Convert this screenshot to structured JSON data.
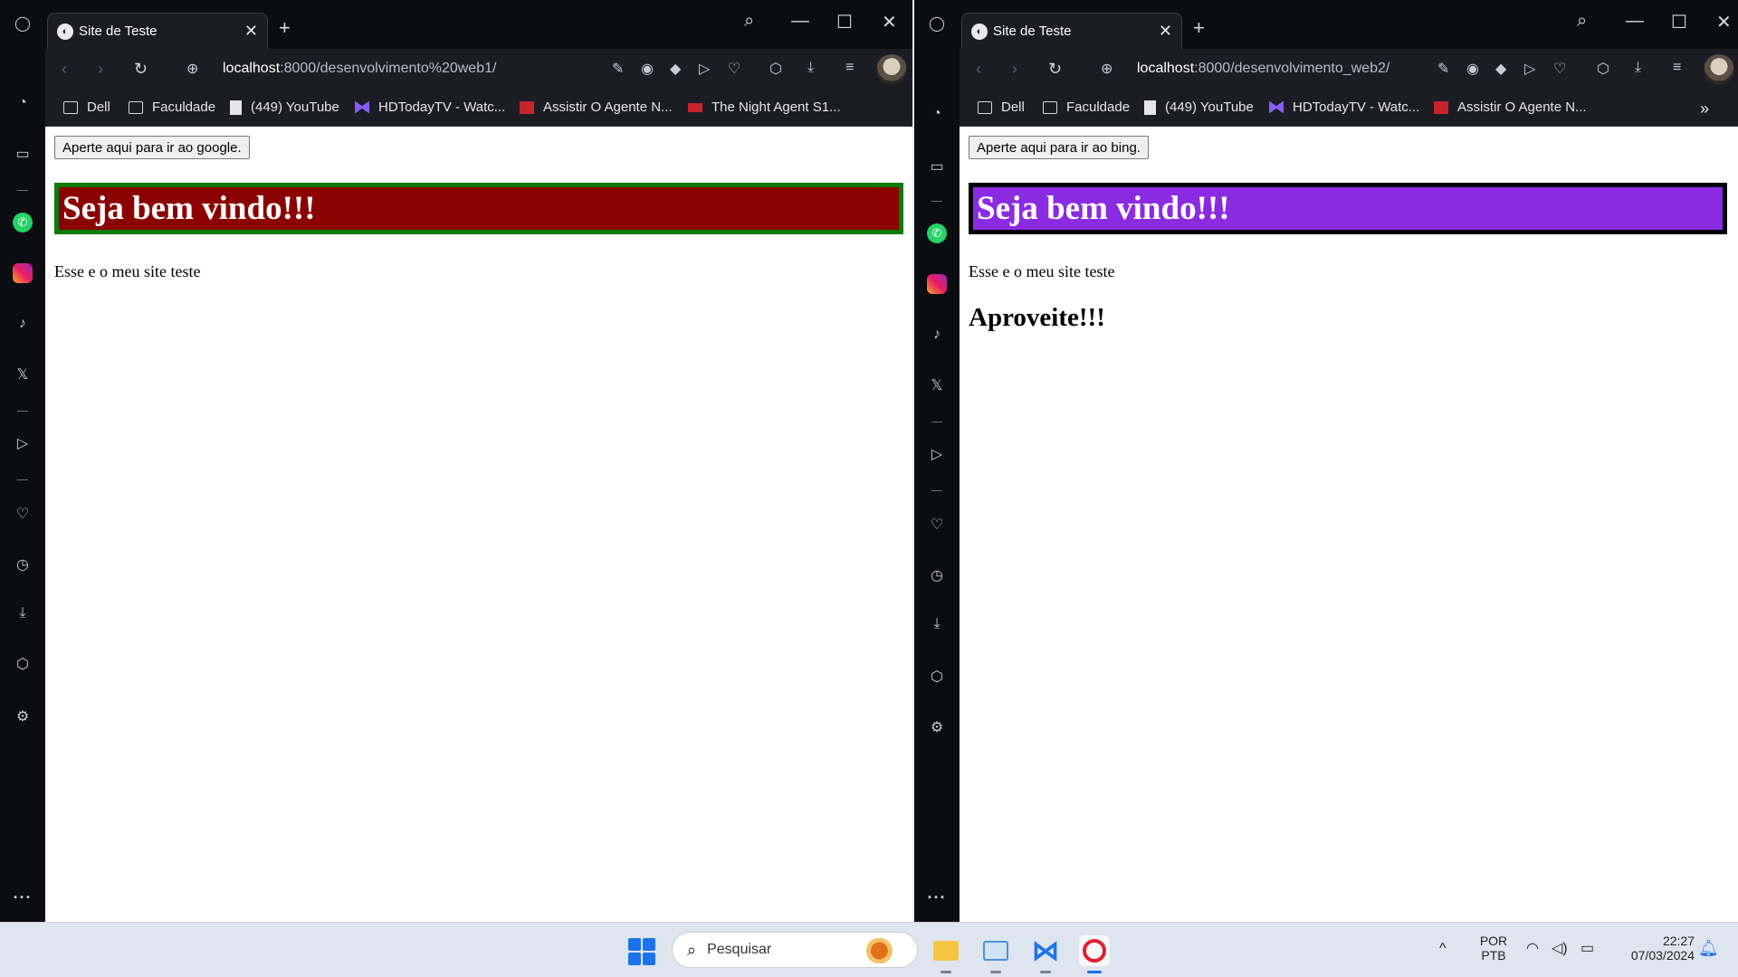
{
  "windows": [
    {
      "tab_title": "Site de Teste",
      "url_host": "localhost",
      "url_path": ":8000/desenvolvimento%20web1/",
      "bookmarks": [
        "Dell",
        "Faculdade",
        "(449) YouTube",
        "HDTodayTV - Watc...",
        "Assistir O Agente N...",
        "The Night Agent S1..."
      ],
      "page": {
        "button_label": "Aperte aqui para ir ao google.",
        "heading": "Seja bem vindo!!!",
        "paragraph": "Esse e o meu site teste",
        "subheading": ""
      }
    },
    {
      "tab_title": "Site de Teste",
      "url_host": "localhost",
      "url_path": ":8000/desenvolvimento_web2/",
      "bookmarks": [
        "Dell",
        "Faculdade",
        "(449) YouTube",
        "HDTodayTV - Watc...",
        "Assistir O Agente N..."
      ],
      "page": {
        "button_label": "Aperte aqui para ir ao bing.",
        "heading": "Seja bem vindo!!!",
        "paragraph": "Esse e o meu site teste",
        "subheading": "Aproveite!!!"
      }
    }
  ],
  "colors": {
    "left_banner_bg": "#8b0000",
    "left_banner_border": "#0b7a0b",
    "right_banner_bg": "#8a2be2",
    "right_banner_border": "#000000"
  },
  "taskbar": {
    "search_placeholder": "Pesquisar",
    "lang_top": "POR",
    "lang_bottom": "PTB",
    "time": "22:27",
    "date": "07/03/2024"
  }
}
